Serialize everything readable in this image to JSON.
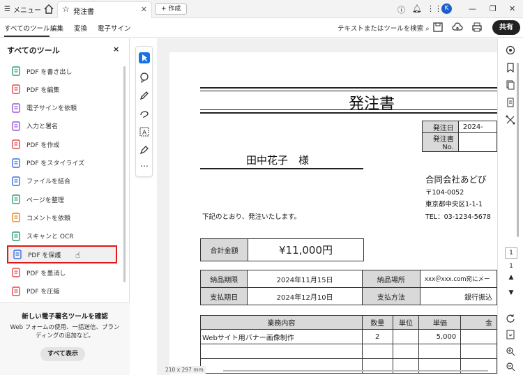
{
  "titlebar": {
    "menu_label": "メニュー",
    "tab_title": "発注書",
    "new_tab_label": "+ 作成",
    "avatar_initial": "K"
  },
  "toolbar": {
    "tabs": [
      "すべてのツール",
      "編集",
      "変換",
      "電子サイン"
    ],
    "search_label": "テキストまたはツールを検索",
    "share_label": "共有"
  },
  "panel": {
    "title": "すべてのツール",
    "close": "×",
    "tools": [
      {
        "label": "PDF を書き出し",
        "color": "#2d9d78"
      },
      {
        "label": "PDF を編集",
        "color": "#e34850"
      },
      {
        "label": "電子サインを依頼",
        "color": "#9256d9"
      },
      {
        "label": "入力と署名",
        "color": "#9256d9"
      },
      {
        "label": "PDF を作成",
        "color": "#e34850"
      },
      {
        "label": "PDF をスタイライズ",
        "color": "#3c6ee6"
      },
      {
        "label": "ファイルを結合",
        "color": "#3c6ee6"
      },
      {
        "label": "ページを整理",
        "color": "#2d9d78"
      },
      {
        "label": "コメントを依頼",
        "color": "#e68619"
      },
      {
        "label": "スキャンと OCR",
        "color": "#2d9d78"
      },
      {
        "label": "PDF を保護",
        "color": "#3c6ee6"
      },
      {
        "label": "PDF を墨消し",
        "color": "#e34850"
      },
      {
        "label": "PDF を圧縮",
        "color": "#e34850"
      }
    ],
    "promo_heading": "新しい電子署名ツールを確認",
    "promo_desc": "Web フォームの使用、一括送信、ブランディングの追加など。",
    "promo_button": "すべて表示"
  },
  "document": {
    "title": "発注書",
    "recipient": "田中花子　様",
    "header_table": [
      [
        "発注日",
        "2024-"
      ],
      [
        "発注書No.",
        ""
      ]
    ],
    "company": {
      "name": "合同会社あどび",
      "zip": "〒104-0052",
      "address": "東京都中央区1-1-1",
      "tel": "TEL：03-1234-5678"
    },
    "intro": "下記のとおり、発注いたします。",
    "total_label": "合計金額",
    "total_value": "¥11,000円",
    "terms": {
      "delivery_label": "納品期限",
      "delivery_value": "2024年11月15日",
      "place_label": "納品場所",
      "place_value": "xxx＠xxx.com宛にメー",
      "payment_label": "支払期日",
      "payment_value": "2024年12月10日",
      "method_label": "支払方法",
      "method_value": "銀行振込"
    },
    "items_header": [
      "業務内容",
      "数量",
      "単位",
      "単価",
      "金"
    ],
    "items": [
      [
        "Webサイト用バナー画像制作",
        "2",
        "",
        "5,000",
        ""
      ]
    ],
    "page_size": "210 x 297 mm"
  },
  "rail": {
    "page_current": "1",
    "page_total": "1"
  }
}
